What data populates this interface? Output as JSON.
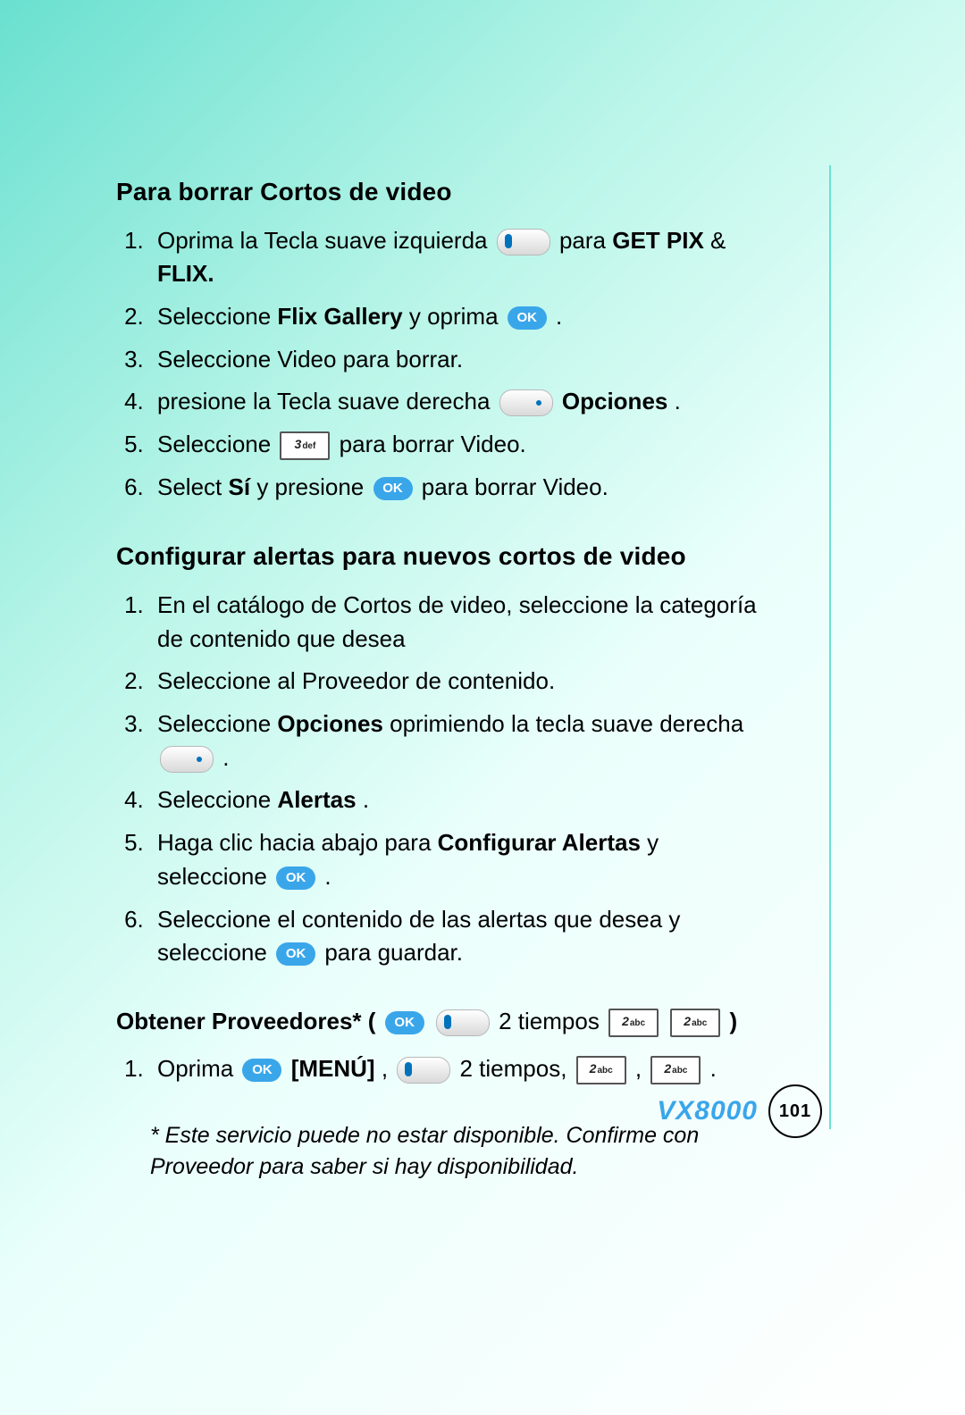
{
  "section1": {
    "heading": "Para borrar Cortos de video",
    "steps": {
      "s1a": "Oprima la Tecla suave izquierda ",
      "s1b": " para ",
      "s1c": "GET PIX",
      "s1d": " & ",
      "s1e": "FLIX.",
      "s2a": "Seleccione ",
      "s2b": "Flix Gallery",
      "s2c": " y oprima ",
      "s2d": " .",
      "s3": "Seleccione Video para borrar.",
      "s4a": "presione la Tecla suave derecha ",
      "s4b": " Opciones",
      "s4c": ".",
      "s5a": "Seleccione ",
      "s5b": " para borrar Video.",
      "s6a": "Select ",
      "s6b": "Sí",
      "s6c": " y presione ",
      "s6d": " para borrar Video."
    }
  },
  "section2": {
    "heading": "Configurar  alertas para nuevos cortos de video",
    "steps": {
      "s1": "En el catálogo de Cortos de video, seleccione la categoría de contenido que desea",
      "s2": "Seleccione al Proveedor de contenido.",
      "s3a": "Seleccione ",
      "s3b": "Opciones",
      "s3c": " oprimiendo la tecla suave derecha ",
      "s3d": " .",
      "s4a": "Seleccione ",
      "s4b": "Alertas",
      "s4c": ".",
      "s5a": "Haga clic hacia abajo para ",
      "s5b": "Configurar Alertas",
      "s5c": " y seleccione ",
      "s5d": " .",
      "s6a": "Seleccione el contenido de las alertas que desea y seleccione ",
      "s6b": " para guardar."
    }
  },
  "section3": {
    "heading_a": "Obtener Proveedores* ( ",
    "heading_b": " 2 tiempos ",
    "heading_c": " )",
    "s1a": "Oprima ",
    "s1b": "[MENÚ]",
    "s1c": ", ",
    "s1d": " 2 tiempos, ",
    "s1e": " , ",
    "s1f": " .",
    "note": "* Este servicio puede no estar disponible. Confirme con Proveedor para saber si hay disponibilidad."
  },
  "keys": {
    "ok": "OK",
    "k3": "3",
    "k3sub": "def",
    "k2": "2",
    "k2sub": "abc"
  },
  "footer": {
    "model": "VX8000",
    "page": "101"
  }
}
